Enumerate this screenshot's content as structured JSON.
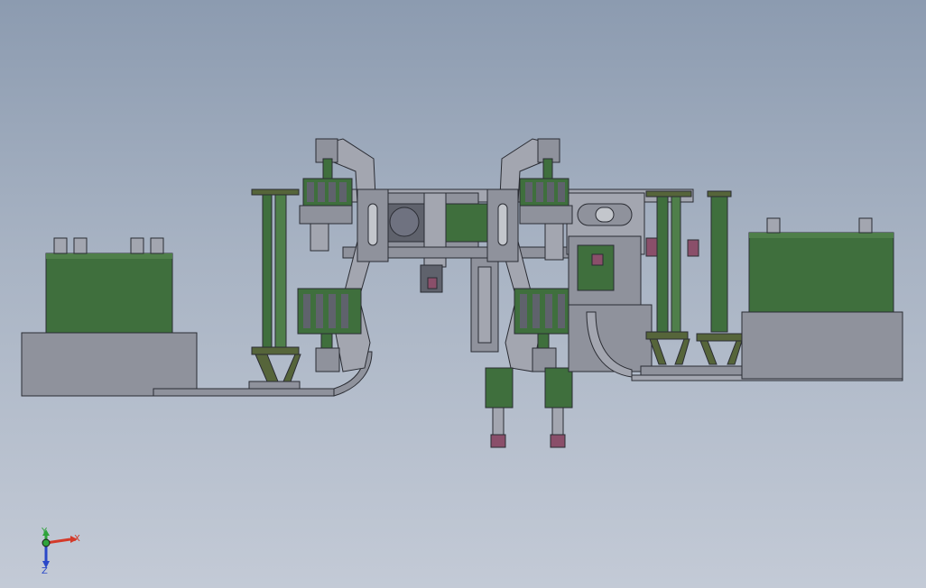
{
  "viewport": {
    "background_top": "#8c9bb0",
    "background_bottom": "#c3cad6"
  },
  "model": {
    "colors": {
      "steel": "#8f929c",
      "steel_light": "#a3a6b0",
      "steel_dark": "#5f626c",
      "green": "#3f6f3d",
      "green_light": "#4f7f4a",
      "olive": "#56653a",
      "magenta": "#8a4f6a",
      "outline": "#2a2c33"
    }
  },
  "triad": {
    "x_label": "X",
    "y_label": "Y",
    "z_label": "Z",
    "x_color": "#d43a2a",
    "y_color": "#2fa33a",
    "z_color": "#2a48c8"
  }
}
